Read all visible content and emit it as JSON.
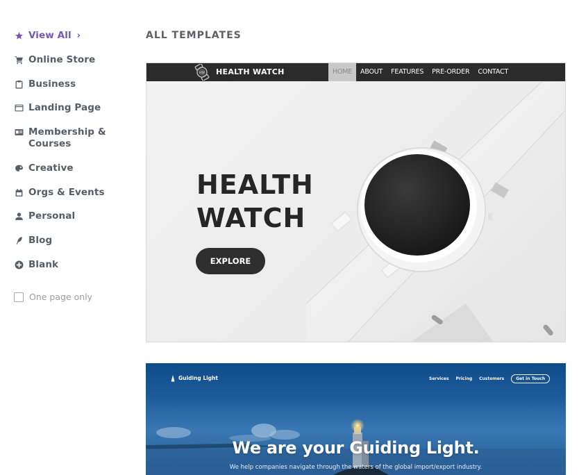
{
  "sidebar": {
    "items": [
      {
        "label": "View All",
        "icon": "star-icon",
        "active": true,
        "chevron": "›"
      },
      {
        "label": "Online Store",
        "icon": "cart-icon"
      },
      {
        "label": "Business",
        "icon": "clipboard-icon"
      },
      {
        "label": "Landing Page",
        "icon": "window-icon"
      },
      {
        "label": "Membership &\nCourses",
        "label_line1": "Membership &",
        "label_line2": "Courses",
        "icon": "id-card-icon"
      },
      {
        "label": "Creative",
        "icon": "palette-icon"
      },
      {
        "label": "Orgs & Events",
        "icon": "calendar-icon"
      },
      {
        "label": "Personal",
        "icon": "person-icon"
      },
      {
        "label": "Blog",
        "icon": "feather-icon"
      },
      {
        "label": "Blank",
        "icon": "plus-circle-icon"
      }
    ],
    "one_page_only": {
      "label": "One page only",
      "checked": false
    }
  },
  "main": {
    "section_title": "ALL TEMPLATES",
    "templates": [
      {
        "name": "Health Watch",
        "brand": "HEALTH WATCH",
        "logo_text": "HW",
        "menu": [
          "HOME",
          "ABOUT",
          "FEATURES",
          "PRE-ORDER",
          "CONTACT"
        ],
        "active_menu": "HOME",
        "hero_line1": "HEALTH",
        "hero_line2": "WATCH",
        "cta": "EXPLORE"
      },
      {
        "name": "Guiding Light",
        "brand": "Guiding Light",
        "menu": [
          "Services",
          "Pricing",
          "Customers"
        ],
        "cta": "Get in Touch",
        "headline": "We are your Guiding Light.",
        "subheadline": "We help companies navigate through the waters of the global import/export industry."
      }
    ]
  },
  "colors": {
    "accent": "#7557b3",
    "sidebar_text": "#555d66",
    "muted_text": "#9a9ca2",
    "hw_nav_bg": "#2b2b2b",
    "gl_blue": "#1d5596"
  }
}
